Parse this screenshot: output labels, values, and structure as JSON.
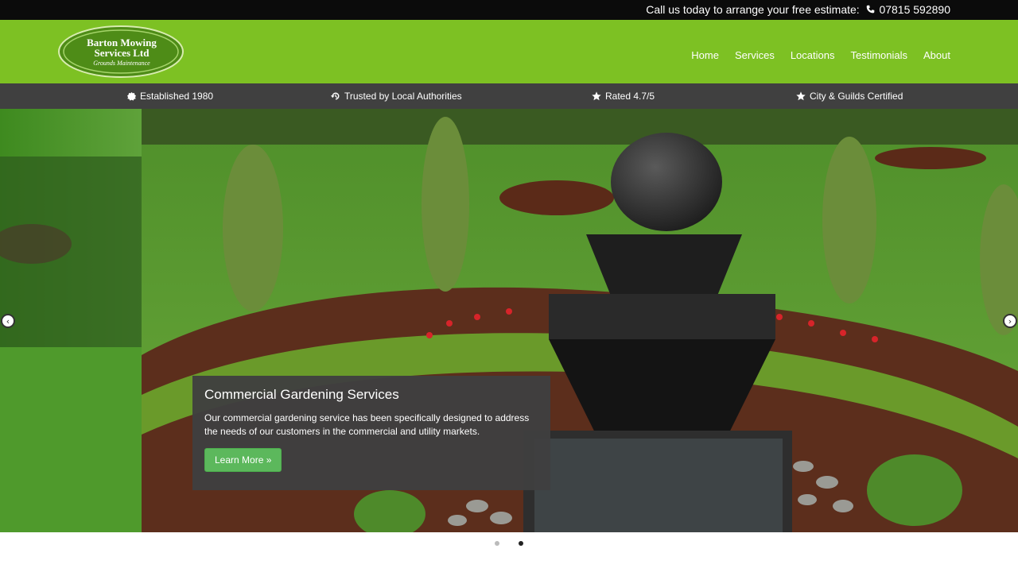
{
  "topbar": {
    "call_text": "Call us today to arrange your free estimate:",
    "phone": "07815 592890",
    "phone_icon": "phone-icon"
  },
  "logo": {
    "line1": "Barton Mowing",
    "line2": "Services Ltd",
    "line3": "Grounds Maintenance"
  },
  "nav": {
    "items": [
      "Home",
      "Services",
      "Locations",
      "Testimonials",
      "About"
    ]
  },
  "features": [
    {
      "icon": "badge-icon",
      "label": "Established 1980"
    },
    {
      "icon": "history-icon",
      "label": "Trusted by Local Authorities"
    },
    {
      "icon": "star-icon",
      "label": "Rated 4.7/5"
    },
    {
      "icon": "star-icon",
      "label": "City & Guilds Certified"
    }
  ],
  "slider": {
    "caption_title": "Commercial Gardening Services",
    "caption_text": "Our commercial gardening service has been specifically designed to address the needs of our customers in the commercial and utility markets.",
    "button_label": "Learn More »",
    "slide_count": 2,
    "active_slide": 2
  },
  "colors": {
    "header_green": "#7dc123",
    "topbar": "#0b0b0b",
    "features_bar": "#404040",
    "button_green": "#5cb85c"
  }
}
